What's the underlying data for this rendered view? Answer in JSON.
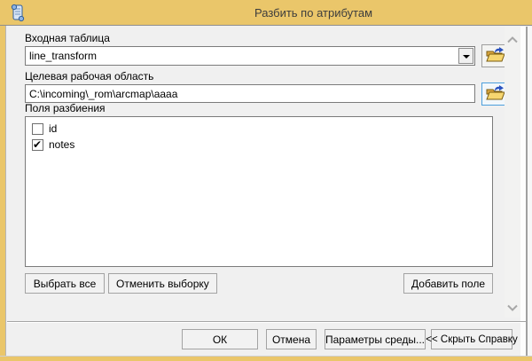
{
  "window": {
    "title": "Разбить по атрибутам",
    "icon": "script-scroll-icon"
  },
  "theme": {
    "title_bar_gold": "#eac66a",
    "dialog_bg": "#f0f0f0",
    "field_border": "#7b7b7b",
    "button_border": "#a3a3a3",
    "focus_border": "#4c9fdc",
    "folder_icon_yellow": "#f6d670",
    "folder_arrow_blue": "#2a52be"
  },
  "form": {
    "input_table": {
      "label": "Входная таблица",
      "value": "line_transform",
      "dropdown_icon": "triangle-down-icon",
      "browse_icon": "open-folder-icon"
    },
    "target_workspace": {
      "label": "Целевая рабочая область",
      "value": "C:\\incoming\\_rom\\arcmap\\aaaa",
      "browse_icon": "open-folder-icon"
    },
    "split_fields": {
      "label": "Поля разбиения",
      "items": [
        {
          "name": "id",
          "checked": false
        },
        {
          "name": "notes",
          "checked": true
        }
      ],
      "select_all_label": "Выбрать все",
      "clear_selection_label": "Отменить выборку",
      "add_field_label": "Добавить поле"
    }
  },
  "scrollbar": {
    "up_icon": "chevron-up-icon",
    "down_icon": "chevron-down-icon"
  },
  "footer": {
    "ok_label": "ОК",
    "cancel_label": "Отмена",
    "environments_label": "Параметры среды...",
    "hide_help_label": "<< Скрыть Справку"
  }
}
